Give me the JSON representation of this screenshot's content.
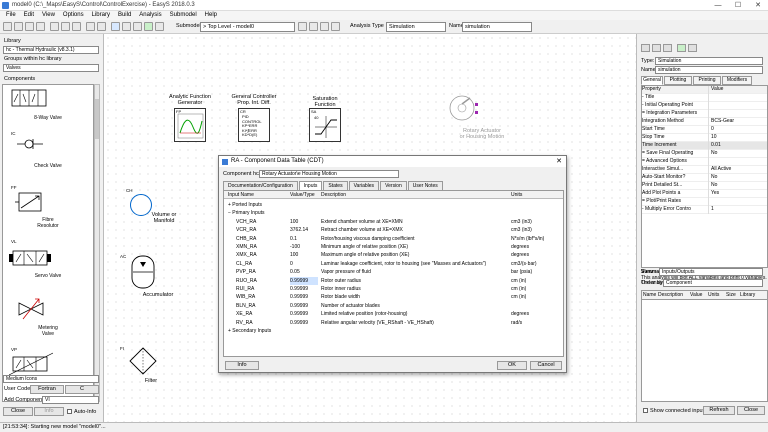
{
  "window": {
    "title": "model0 (C:\\_Maps\\EasyS\\Control\\ControlExercise) - EasyS 2018.0.3",
    "controls": [
      "—",
      "☐",
      "✕"
    ]
  },
  "menu": [
    "File",
    "Edit",
    "View",
    "Options",
    "Library",
    "Build",
    "Analysis",
    "Submodel",
    "Help"
  ],
  "toolbar": {
    "submodel_label": "Submodel",
    "submodel_value": "> Top Level - model0",
    "analysis_type_label": "Analysis Type",
    "analysis_type_value": "Simulation",
    "name_label": "Name",
    "name_value": "simulation"
  },
  "left": {
    "library_label": "Library",
    "library_value": "hc - Thermal Hydraulic (v8.3.1)",
    "groups_label": "Groups within hc library",
    "groups_value": "Valves",
    "components_label": "Components",
    "components": [
      {
        "tag": "",
        "name": "8-Way Valve"
      },
      {
        "tag": "IC",
        "name": "Check Valve"
      },
      {
        "tag": "FF",
        "name": "Fibre\nResolutor"
      },
      {
        "tag": "VL",
        "name": "Servo Valve"
      },
      {
        "tag": "",
        "name": "Metering\nValve"
      },
      {
        "tag": "VP",
        "name": ""
      }
    ],
    "icon_size_value": "Medium Icons",
    "user_code_label": "User Code:",
    "fortran_btn": "Fortran",
    "c_btn": "C",
    "add_component_label": "Add Component",
    "add_component_value": "VI",
    "close_btn": "Close",
    "info_btn": "Info",
    "autoinfo_label": "Auto-Info"
  },
  "canvas": {
    "blocks": [
      {
        "name": "Analytic Function\nGenerator",
        "tag": "FP"
      },
      {
        "name": "General Controller\nProp. Int. Diff.",
        "tag": "CR",
        "inner": "PID\nCONTROL\nKP*ERR\nKI*∫ERR\nKD*D(E)"
      },
      {
        "name": "Saturation\nFunction",
        "tag": "SA",
        "inner": "40"
      },
      {
        "name": "Rotary Actuator\nor Housing Motion",
        "tag": ""
      },
      {
        "name": "Volume or\nManifold",
        "tag": "CH"
      },
      {
        "name": "Accumulator",
        "tag": "AC"
      },
      {
        "name": "Filter",
        "tag": "FI"
      }
    ]
  },
  "right": {
    "type_label": "Type:",
    "type_value": "Simulation",
    "name_label": "Name:",
    "name_value": "simulation",
    "tabs": [
      "General",
      "Plotting",
      "Printing",
      "Modifiers"
    ],
    "prop_header": "Property",
    "value_header": "Value",
    "props": [
      {
        "k": "- Title",
        "v": ""
      },
      {
        "k": "- Initial Operating Point",
        "v": ""
      },
      {
        "k": "= Integration Parameters",
        "v": ""
      },
      {
        "k": "   Integration Method",
        "v": "BCS-Gear"
      },
      {
        "k": "   Start Time",
        "v": "0"
      },
      {
        "k": "   Stop Time",
        "v": "10"
      },
      {
        "k": "   Time Increment",
        "v": "0.01"
      },
      {
        "k": "= Save Final Operating",
        "v": "No"
      },
      {
        "k": "= Advanced Options",
        "v": ""
      },
      {
        "k": "   Interactive Simul...",
        "v": "All Active"
      },
      {
        "k": "   Auto-Start Monitor?",
        "v": "No"
      },
      {
        "k": "   Print Detailed St...",
        "v": "No"
      },
      {
        "k": "   Add Plot Points a",
        "v": "Yes"
      },
      {
        "k": "= Plot/Print Rates",
        "v": ""
      },
      {
        "k": "- Multiply Error Contro",
        "v": "1"
      }
    ],
    "summary_title": "Summary:",
    "summary_text": "This analysis will plot ALL variables and print 0 variables. The analysis will use 0 modifier files.",
    "view_label": "View",
    "view_value": "Inputs/Outputs",
    "order_label": "Order by",
    "order_value": "Component",
    "list_headers": [
      "Name",
      "Description",
      "Value",
      "Units",
      "Size",
      "Library"
    ],
    "show_connected": "Show connected inputs",
    "refresh_btn": "Refresh",
    "close_btn": "Close"
  },
  "dialog": {
    "title": "RA - Component Data Table (CDT)",
    "component_label": "Component hc/RA",
    "component_value": "Rotary Actuator\\e Housing Motion",
    "tabs": [
      "Documentation/Configuration",
      "Inputs",
      "States",
      "Variables",
      "Version",
      "User Notes"
    ],
    "headers": [
      "Input Name",
      "Value/Type",
      "Description",
      "Units"
    ],
    "rows": [
      {
        "name": "+ Ported Inputs",
        "value": "",
        "desc": "",
        "units": ""
      },
      {
        "name": "− Primary Inputs",
        "value": "",
        "desc": "",
        "units": ""
      },
      {
        "name": "VCH_RA",
        "value": "100",
        "desc": "Extend chamber volume at XE=XMN",
        "units": "cm3 (in3)"
      },
      {
        "name": "VCR_RA",
        "value": "3762.14",
        "desc": "Retract chamber volume at XE=XMX",
        "units": "cm3 (in3)"
      },
      {
        "name": "CHB_RA",
        "value": "0.1",
        "desc": "Rotor/housing viscous damping coefficient",
        "units": "N*s/m (lbf*s/in)"
      },
      {
        "name": "XMN_RA",
        "value": "-100",
        "desc": "Minimum angle of relative position (XE)",
        "units": "degrees"
      },
      {
        "name": "XMX_RA",
        "value": "100",
        "desc": "Maximum angle of relative position (XE)",
        "units": "degrees"
      },
      {
        "name": "CL_RA",
        "value": "0",
        "desc": "Laminar leakage coefficient, rotor to housing (see \"Masses and Actuators\")",
        "units": "cm3/(s·bar)"
      },
      {
        "name": "PVP_RA",
        "value": "0.05",
        "desc": "Vapor pressure of fluid",
        "units": "bar (psia)"
      },
      {
        "name": "RUO_RA",
        "value": "0.99999",
        "desc": "Rotor outer radius",
        "units": "cm (in)"
      },
      {
        "name": "RUI_RA",
        "value": "0.99999",
        "desc": "Rotor inner radius",
        "units": "cm (in)"
      },
      {
        "name": "WIB_RA",
        "value": "0.99999",
        "desc": "Rotor blade width",
        "units": "cm (in)"
      },
      {
        "name": "BLN_RA",
        "value": "0.99999",
        "desc": "Number of actuator blades",
        "units": ""
      },
      {
        "name": "XE_RA",
        "value": "0.99999",
        "desc": "Limited relative position (rotor-housing)",
        "units": "degrees"
      },
      {
        "name": "RV_RA",
        "value": "0.99999",
        "desc": "Relative angular velocity (VE_RShaft - VE_HShaft)",
        "units": "rad/s"
      },
      {
        "name": "+ Secondary Inputs",
        "value": "",
        "desc": "",
        "units": ""
      }
    ],
    "info_btn": "Info",
    "ok_btn": "OK",
    "cancel_btn": "Cancel"
  },
  "status": "[21:53:34]: Starting new model \"model0\"..."
}
